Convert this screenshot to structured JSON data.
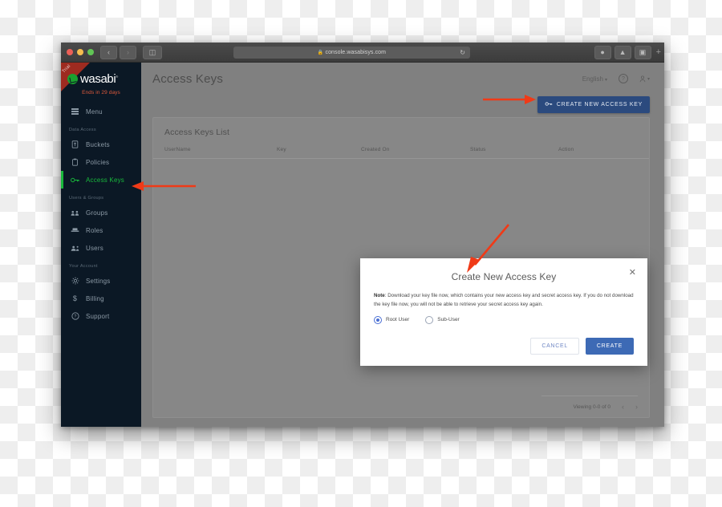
{
  "browser": {
    "url": "console.wasabisys.com",
    "lock_icon": "lock-icon",
    "reload_icon": "reload-icon",
    "back_icon": "back-icon",
    "forward_icon": "forward-icon",
    "sidebar_toggle_icon": "sidebar-toggle-icon",
    "download_icon": "download-icon",
    "share_icon": "share-icon",
    "tabs_icon": "tabs-overview-icon",
    "new_tab_label": "+"
  },
  "sidebar": {
    "trial_ribbon": "Trial",
    "logo_text": "wasabi",
    "logo_tm": "®",
    "trial_notice": "Ends in 29 days",
    "menu_label": "Menu",
    "sections": [
      {
        "label": "Data Access",
        "items": [
          {
            "label": "Buckets",
            "icon": "bucket-icon",
            "active": false
          },
          {
            "label": "Policies",
            "icon": "clipboard-icon",
            "active": false
          },
          {
            "label": "Access Keys",
            "icon": "key-icon",
            "active": true
          }
        ]
      },
      {
        "label": "Users & Groups",
        "items": [
          {
            "label": "Groups",
            "icon": "groups-icon",
            "active": false
          },
          {
            "label": "Roles",
            "icon": "roles-icon",
            "active": false
          },
          {
            "label": "Users",
            "icon": "users-icon",
            "active": false
          }
        ]
      },
      {
        "label": "Your Account",
        "items": [
          {
            "label": "Settings",
            "icon": "gear-icon",
            "active": false
          },
          {
            "label": "Billing",
            "icon": "dollar-icon",
            "active": false
          },
          {
            "label": "Support",
            "icon": "help-circle-icon",
            "active": false
          }
        ]
      }
    ]
  },
  "header": {
    "title": "Access Keys",
    "language": "English",
    "help_icon": "help-circle-icon",
    "account_icon": "person-icon",
    "create_key_button": "CREATE NEW ACCESS KEY",
    "create_key_icon": "key-icon"
  },
  "list": {
    "title": "Access Keys List",
    "columns": [
      "UserName",
      "Key",
      "Created On",
      "Status",
      "Action"
    ],
    "rows": [],
    "pagination": {
      "viewing": "Viewing 0-0 of 0",
      "prev_icon": "chevron-left-icon",
      "next_icon": "chevron-right-icon"
    }
  },
  "modal": {
    "title": "Create New Access Key",
    "close_icon": "close-icon",
    "note_label": "Note",
    "note_text": ": Download your key file now, which contains your new access key and secret access key. If you do not download the key file now, you will not be able to retrieve your secret access key again.",
    "options": [
      {
        "label": "Root User",
        "selected": true
      },
      {
        "label": "Sub-User",
        "selected": false
      }
    ],
    "cancel_label": "CANCEL",
    "create_label": "CREATE"
  },
  "annotations": {
    "arrow_color": "#f03a17",
    "arrows": [
      {
        "name": "arrow-to-create-new-access-key-button"
      },
      {
        "name": "arrow-to-access-keys-nav-item"
      },
      {
        "name": "arrow-to-create-button"
      }
    ]
  },
  "colors": {
    "sidebar_bg": "#0b1825",
    "accent_green": "#19b83c",
    "primary_blue": "#3d6ab5",
    "header_button_blue": "#2b4a7e",
    "trial_red": "#9e2b20"
  }
}
